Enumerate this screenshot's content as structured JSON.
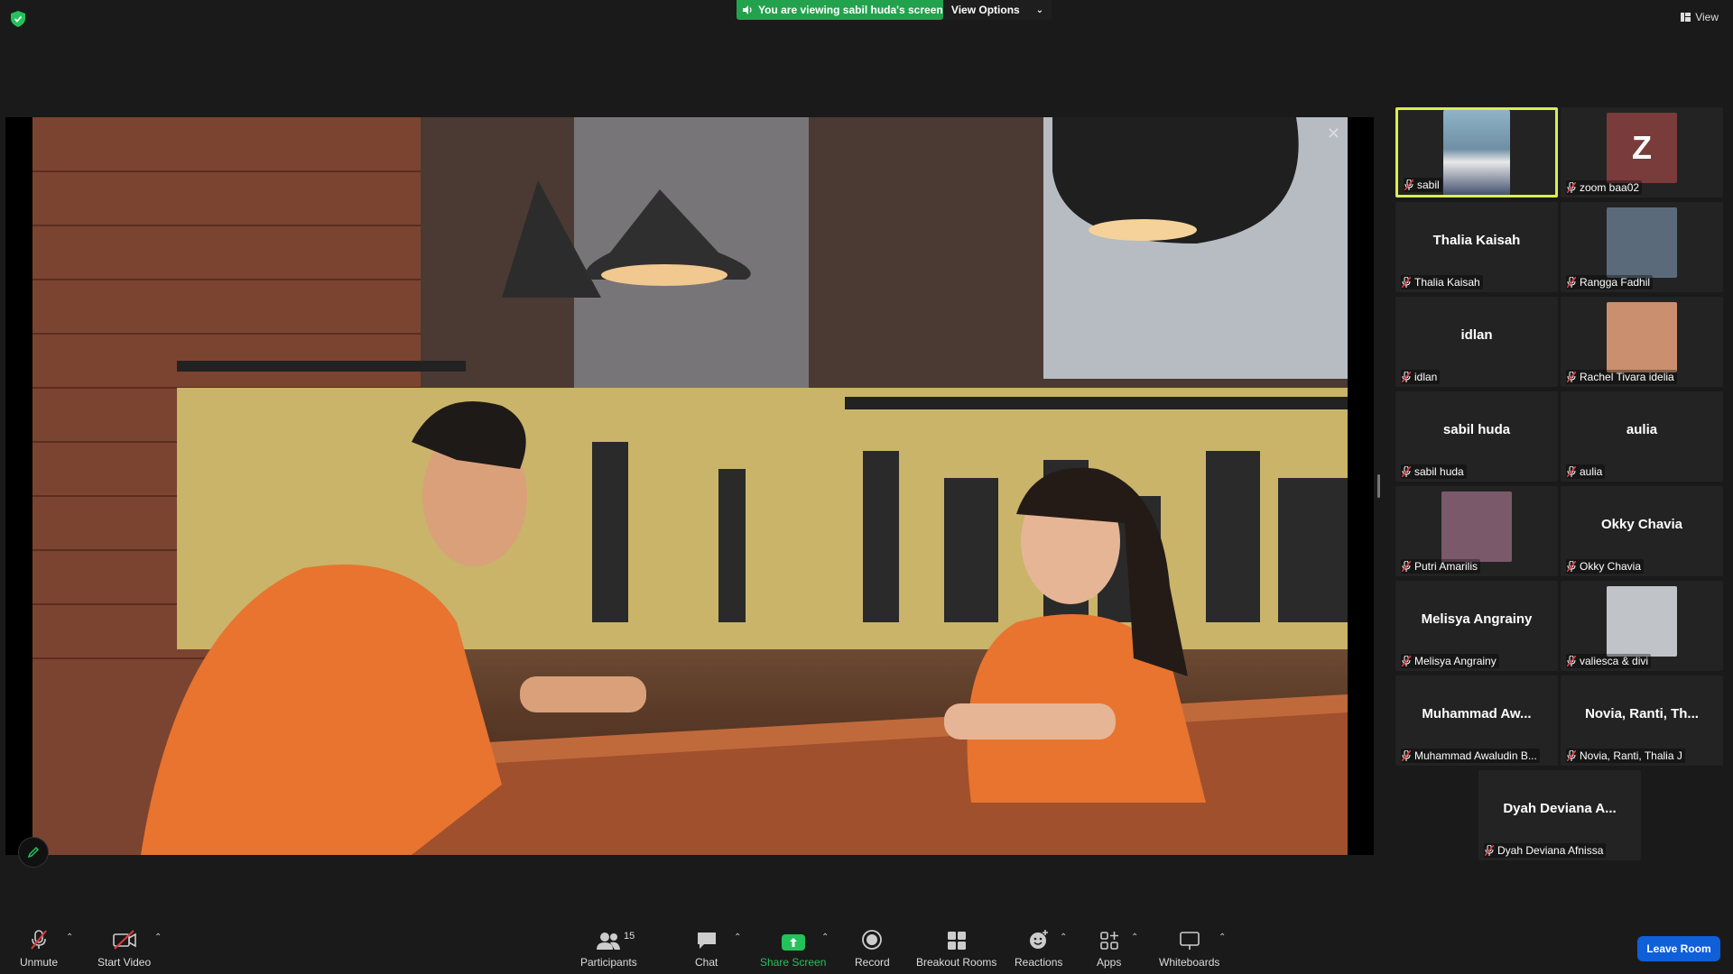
{
  "banner": {
    "viewing_text": "You are viewing sabil huda's screen",
    "view_options_label": "View Options",
    "view_label": "View"
  },
  "gallery": [
    {
      "label": "sabil",
      "big": "",
      "type": "video",
      "active": true
    },
    {
      "label": "zoom baa02",
      "big": "",
      "type": "letter",
      "letter": "Z"
    },
    {
      "label": "Thalia Kaisah",
      "big": "Thalia Kaisah",
      "type": "name"
    },
    {
      "label": "Rangga Fadhil",
      "big": "",
      "type": "photo"
    },
    {
      "label": "idlan",
      "big": "idlan",
      "type": "name"
    },
    {
      "label": "Rachel Tivara idelia",
      "big": "",
      "type": "photo"
    },
    {
      "label": "sabil huda",
      "big": "sabil huda",
      "type": "name"
    },
    {
      "label": "aulia",
      "big": "aulia",
      "type": "name"
    },
    {
      "label": "Putri Amarilis",
      "big": "",
      "type": "photo"
    },
    {
      "label": "Okky Chavia",
      "big": "Okky Chavia",
      "type": "name"
    },
    {
      "label": "Melisya Angrainy",
      "big": "Melisya Angrainy",
      "type": "name"
    },
    {
      "label": "valiesca & divi",
      "big": "",
      "type": "photo"
    },
    {
      "label": "Muhammad Awaludin B...",
      "big": "Muhammad Aw...",
      "type": "name"
    },
    {
      "label": "Novia, Ranti, Thalia J",
      "big": "Novia, Ranti, Th...",
      "type": "name"
    },
    {
      "label": "Dyah Deviana Afnissa",
      "big": "Dyah Deviana A...",
      "type": "name"
    }
  ],
  "toolbar": {
    "unmute": "Unmute",
    "start_video": "Start Video",
    "participants": "Participants",
    "participants_count": "15",
    "chat": "Chat",
    "share_screen": "Share Screen",
    "record": "Record",
    "breakout_rooms": "Breakout Rooms",
    "reactions": "Reactions",
    "apps": "Apps",
    "whiteboards": "Whiteboards",
    "leave_room": "Leave Room"
  },
  "colors": {
    "share_green": "#23a24d",
    "active_speaker": "#d9ef50",
    "leave_blue": "#0e5fd8",
    "mic_off_red": "#e0393e"
  }
}
